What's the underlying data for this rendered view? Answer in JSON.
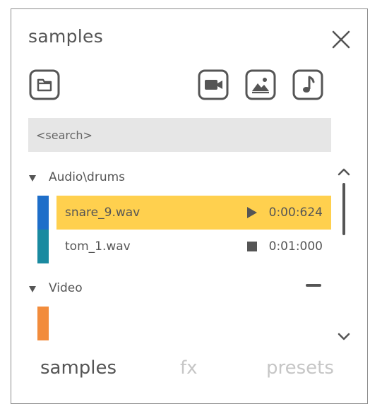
{
  "panel": {
    "title": "samples"
  },
  "toolbar": {
    "icons": [
      "folder-icon",
      "video-camera-icon",
      "image-icon",
      "music-note-icon"
    ]
  },
  "search": {
    "text": "<search>"
  },
  "groups": [
    {
      "label": "Audio\\drums",
      "items": [
        {
          "name": "snare_9.wav",
          "time": "0:00:624",
          "state": "playing",
          "color": "#1e6ec9",
          "selected": true
        },
        {
          "name": "tom_1.wav",
          "time": "0:01:000",
          "state": "stopped",
          "color": "#1a8aa0",
          "selected": false
        }
      ]
    },
    {
      "label": "Video",
      "items": [
        {
          "color": "#f28c3c"
        }
      ]
    }
  ],
  "tabs": [
    {
      "label": "samples",
      "active": true
    },
    {
      "label": "fx",
      "active": false
    },
    {
      "label": "presets",
      "active": false
    }
  ],
  "colors": {
    "selection": "#ffd04e",
    "icon": "#555555",
    "search_bg": "#e6e6e6",
    "inactive_tab": "#c6c6c6"
  }
}
